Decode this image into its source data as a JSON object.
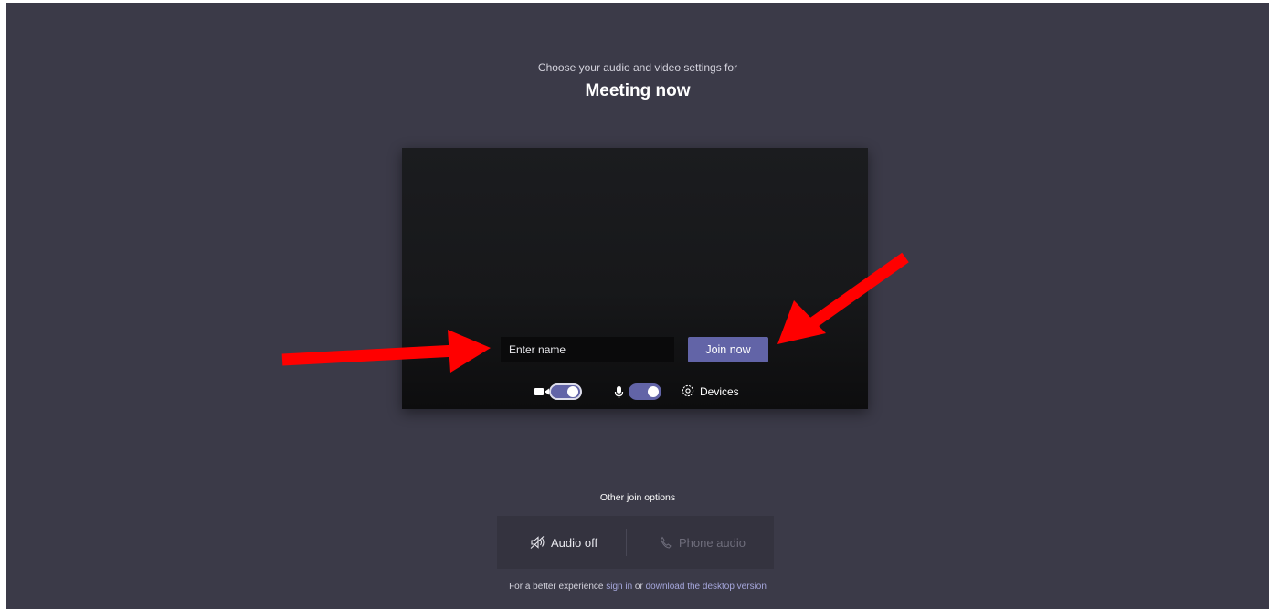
{
  "header": {
    "subtitle": "Choose your audio and video settings for",
    "meeting_title": "Meeting now"
  },
  "prejoin": {
    "name_placeholder": "Enter name",
    "join_label": "Join now",
    "camera_toggle": {
      "icon": "camera-icon",
      "on": true
    },
    "mic_toggle": {
      "icon": "microphone-icon",
      "on": true
    },
    "devices_label": "Devices",
    "devices_icon": "gear-icon"
  },
  "other_options": {
    "title": "Other join options",
    "audio_off_label": "Audio off",
    "audio_off_icon": "speaker-off-icon",
    "phone_audio_label": "Phone audio",
    "phone_audio_icon": "phone-icon"
  },
  "footer": {
    "prefix": "For a better experience",
    "sign_in_link": "sign in",
    "middle": "or",
    "download_link": "download the desktop version"
  },
  "colors": {
    "background": "#3b3a48",
    "accent": "#6264a7",
    "annotation_arrow": "#ff0000"
  }
}
